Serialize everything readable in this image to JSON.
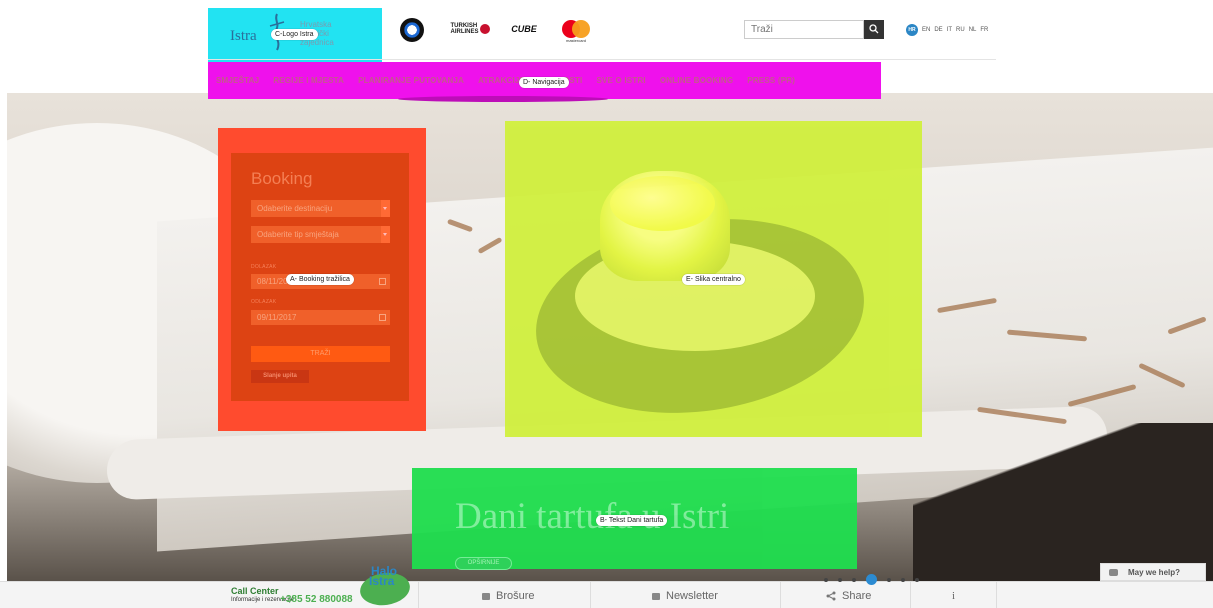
{
  "header": {
    "logo_text": "Istra",
    "logo_sub": "Hrvatska turistički zajednica",
    "sponsors": {
      "turkish": "TURKISH AIRLINES",
      "cube": "CUBE",
      "mastercard": "mastercard"
    },
    "search_placeholder": "Traži",
    "languages": [
      "HR",
      "EN",
      "DE",
      "IT",
      "RU",
      "NL",
      "FR"
    ]
  },
  "nav": {
    "items": [
      "SMJEŠTAJ",
      "REGIJE I MJESTA",
      "PLANIRANJE PUTOVANJA",
      "ATRAKCIJE I AKTIVNOSTI",
      "SVE O ISTRI",
      "ONLINE BOOKING",
      "PRESS (PR)"
    ]
  },
  "booking": {
    "title": "Booking",
    "destination": "Odaberite destinaciju",
    "accommodation": "Odaberite tip smještaja",
    "arrival_label": "DOLAZAK",
    "arrival": "08/11/2017",
    "departure_label": "ODLAZAK",
    "departure": "09/11/2017",
    "search_button": "TRAŽI",
    "inquiry_button": "Slanje upita"
  },
  "hero": {
    "title": "Dani tartufa u Istri",
    "button": "OPŠIRNIJE"
  },
  "annotations": {
    "logo": "C-Logo Istra",
    "nav": "D- Navigacija",
    "booking": "A- Booking tražilica",
    "image": "E- Slika centralno",
    "text": "B- Tekst Dani tartufa"
  },
  "chat": {
    "label": "May we help?"
  },
  "footer": {
    "cc_title": "Call Center",
    "cc_sub": "Informacije i rezervacije",
    "cc_phone": "+385 52 880088",
    "halo_1": "Halo",
    "halo_2": "Istra",
    "brochures": "Brošure",
    "newsletter": "Newsletter",
    "share": "Share",
    "info": "i"
  },
  "colors": {
    "zone_booking": "#ff4b2e",
    "zone_image": "#d0f03a",
    "zone_text": "#1fde4e",
    "zone_nav": "#ef11ec",
    "zone_logo": "#22e3f2"
  }
}
